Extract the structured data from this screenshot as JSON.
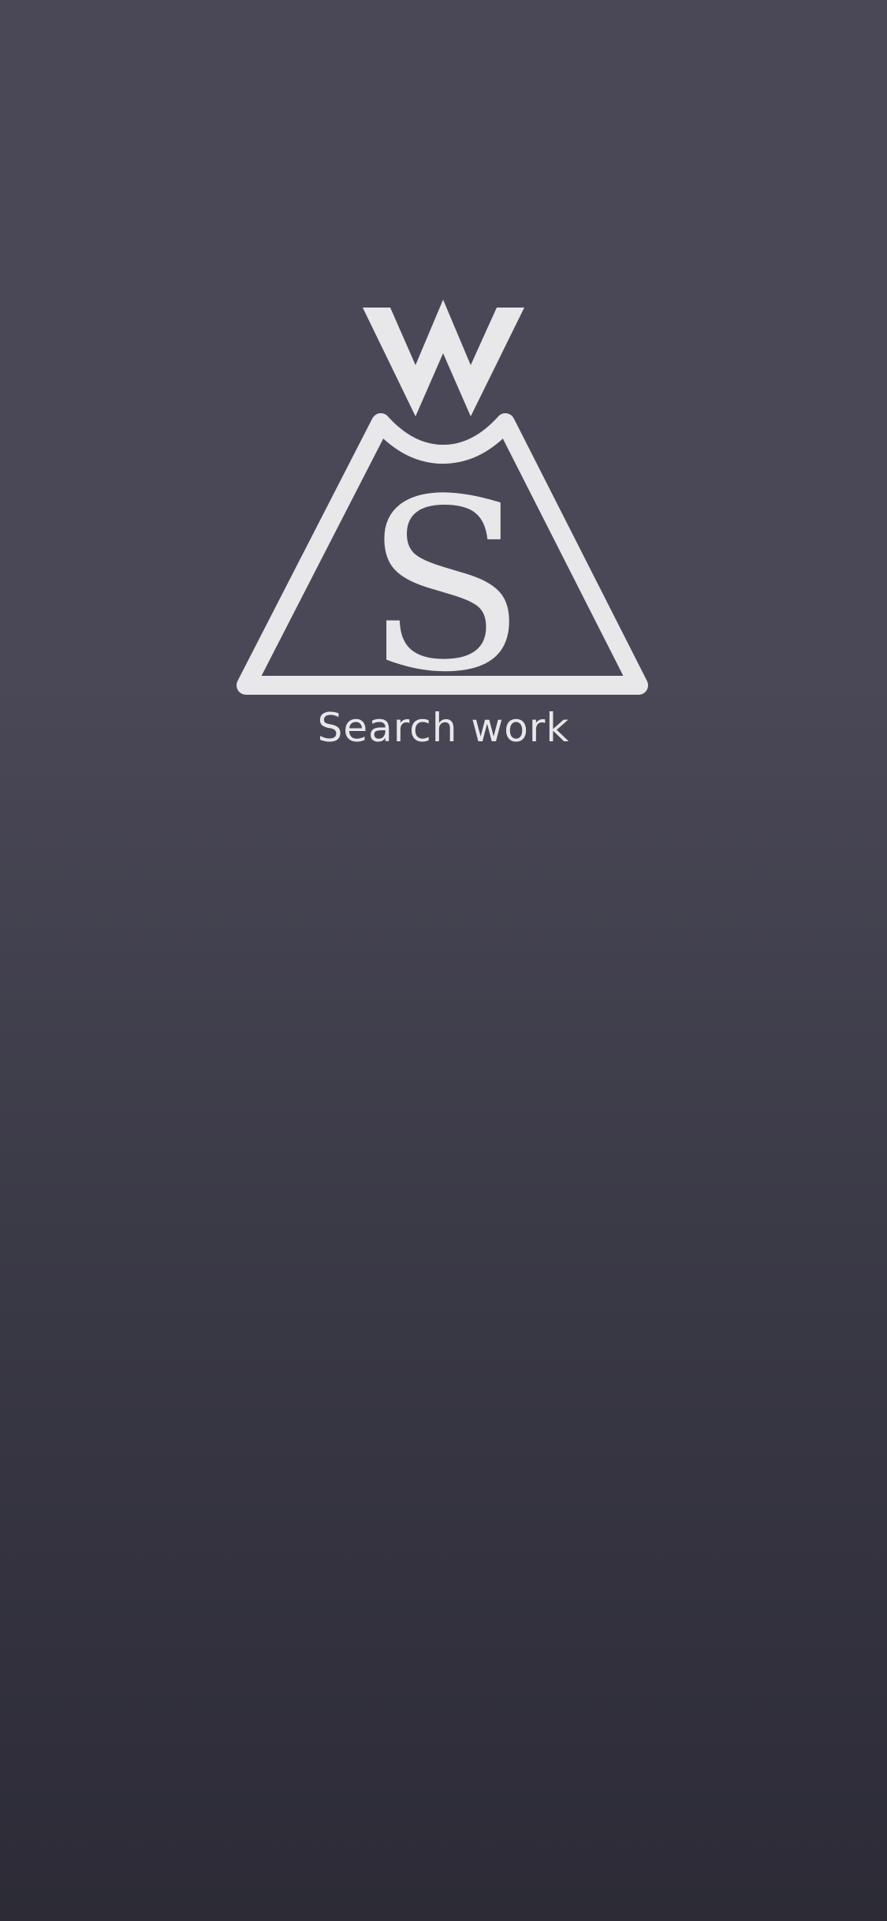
{
  "screen": {
    "app_name": "Search work",
    "background_top": "#4a4856",
    "background_bottom": "#2c2b36",
    "logo_color": "#e8e8ea",
    "logo": {
      "icon": "ws-triangle-logo-icon",
      "letters": [
        "W",
        "S"
      ]
    }
  }
}
